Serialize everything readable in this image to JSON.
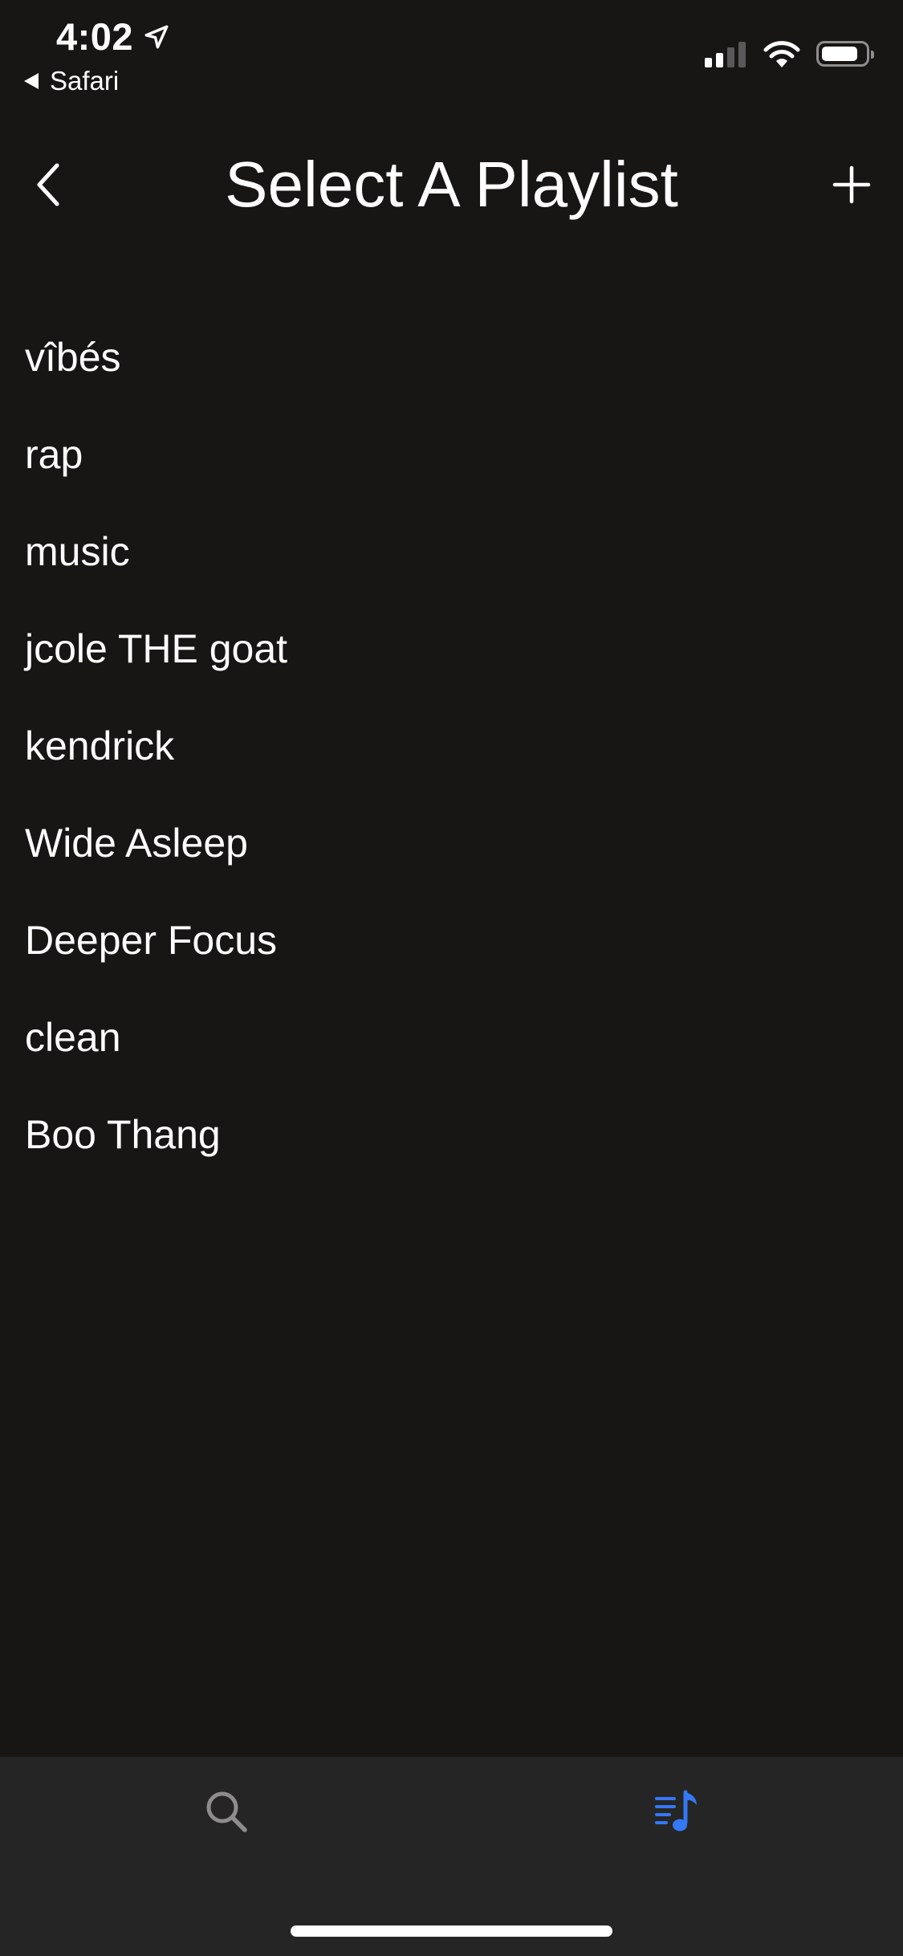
{
  "status_bar": {
    "time": "4:02",
    "back_app_label": "Safari",
    "battery_level": 0.85,
    "signal_bars": 2,
    "signal_bars_total": 4
  },
  "header": {
    "title": "Select A Playlist",
    "back_icon": "chevron-left-icon",
    "add_icon": "plus-icon"
  },
  "playlists": [
    {
      "label": "vîbés"
    },
    {
      "label": "rap"
    },
    {
      "label": "music"
    },
    {
      "label": "jcole THE goat"
    },
    {
      "label": "kendrick"
    },
    {
      "label": "Wide Asleep"
    },
    {
      "label": "Deeper Focus"
    },
    {
      "label": "clean"
    },
    {
      "label": "Boo Thang"
    }
  ],
  "tab_bar": {
    "tabs": [
      {
        "icon": "search-icon",
        "active": false
      },
      {
        "icon": "playlist-music-icon",
        "active": true
      }
    ],
    "active_color": "#3478f6",
    "inactive_color": "#8e8c8c"
  },
  "colors": {
    "background": "#181515",
    "tab_bar_background": "#262525",
    "text": "#ffffff"
  }
}
